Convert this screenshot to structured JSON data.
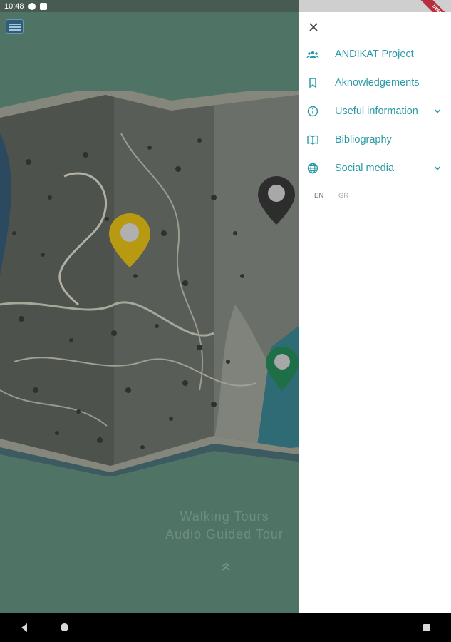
{
  "status_bar": {
    "time": "10:48"
  },
  "main": {
    "tour_lines": [
      "Walking Tours",
      "Audio Guided Tour"
    ]
  },
  "map": {
    "pins": [
      {
        "name": "yellow-pin",
        "color": "#b79a12"
      },
      {
        "name": "dark-pin",
        "color": "#2d2d2d"
      },
      {
        "name": "green-pin",
        "color": "#1e6f47"
      }
    ]
  },
  "drawer": {
    "menu": [
      {
        "label": "ANDIKAT Project",
        "icon": "people-icon",
        "expandable": false
      },
      {
        "label": "Aknowledgements",
        "icon": "bookmark-icon",
        "expandable": false
      },
      {
        "label": "Useful information",
        "icon": "info-icon",
        "expandable": true
      },
      {
        "label": "Bibliography",
        "icon": "book-icon",
        "expandable": false
      },
      {
        "label": "Social media",
        "icon": "globe-icon",
        "expandable": true
      }
    ],
    "languages": [
      "EN",
      "GR"
    ]
  },
  "colors": {
    "accent": "#2a9aa6",
    "background": "#4f7465",
    "drawer": "#ffffff"
  }
}
